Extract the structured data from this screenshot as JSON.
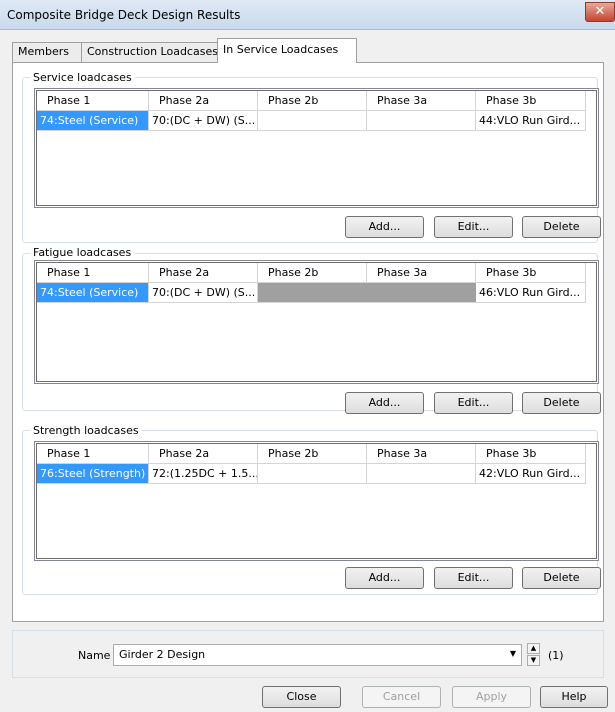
{
  "window": {
    "title": "Composite Bridge Deck Design Results",
    "close_glyph": "✕"
  },
  "tabs": [
    {
      "label": "Members"
    },
    {
      "label": "Construction Loadcases"
    },
    {
      "label": "In Service Loadcases"
    }
  ],
  "columns": [
    "Phase 1",
    "Phase 2a",
    "Phase 2b",
    "Phase 3a",
    "Phase 3b"
  ],
  "service": {
    "label": "Service loadcases",
    "row": [
      "74:Steel (Service)",
      "70:(DC + DW) (S...",
      "",
      "",
      "44:VLO Run Gird..."
    ]
  },
  "fatigue": {
    "label": "Fatigue loadcases",
    "row": [
      "74:Steel (Service)",
      "70:(DC + DW) (S...",
      "",
      "",
      "46:VLO Run Gird..."
    ]
  },
  "strength": {
    "label": "Strength loadcases",
    "row": [
      "76:Steel (Strength)",
      "72:(1.25DC + 1.5...",
      "",
      "",
      "42:VLO Run Gird..."
    ]
  },
  "buttons": {
    "add": "Add...",
    "edit": "Edit...",
    "delete": "Delete"
  },
  "name": {
    "label": "Name",
    "value": "Girder 2 Design",
    "count": "(1)",
    "arrow": "▼",
    "up": "▲",
    "down": "▼"
  },
  "footer": {
    "close": "Close",
    "cancel": "Cancel",
    "apply": "Apply",
    "help": "Help"
  },
  "colors": {
    "selection": "#3399ff",
    "disabled_cell": "#a0a0a0"
  }
}
